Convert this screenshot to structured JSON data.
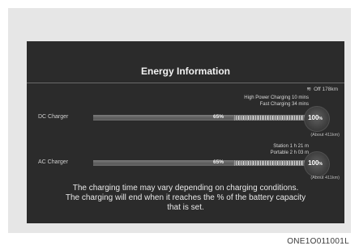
{
  "screen": {
    "title": "Energy Information",
    "range_text": "Off 178km",
    "dc": {
      "label": "DC Charger",
      "time_high": "High Power Charging 10 mins",
      "time_fast": "Fast Charging 34 mins",
      "current_pct": "65%",
      "current_level": 0.65,
      "target": "100",
      "target_unit": "%",
      "about": "(About 411km)"
    },
    "ac": {
      "label": "AC Charger",
      "time_station": "Station 1 h 21 m",
      "time_portable": "Portable 2 h 03 m",
      "current_pct": "65%",
      "current_level": 0.65,
      "target": "100",
      "target_unit": "%",
      "about": "(About 411km)"
    },
    "note_line1": "The charging time may vary depending on charging conditions.",
    "note_line2": "The charging will end when it reaches the % of the battery capacity",
    "note_line3": "that is set."
  },
  "caption": "ONE1O011001L",
  "colors": {
    "screen_bg": "#2b2b2b",
    "frame_bg": "#e6e6e6"
  },
  "icons": {
    "range": "plug-icon"
  }
}
